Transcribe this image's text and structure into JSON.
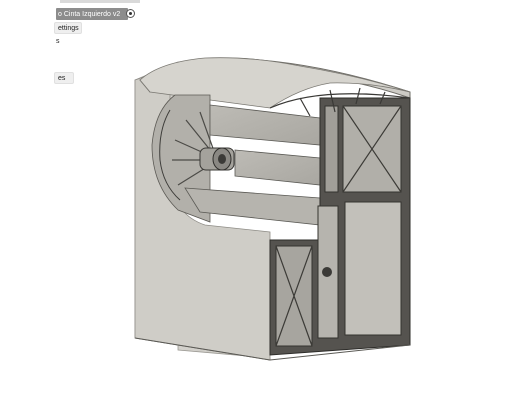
{
  "browser": {
    "document_row": {
      "label": "o Cinta Izquierdo v2"
    },
    "rows": [
      {
        "label": "ettings"
      },
      {
        "label": "s"
      },
      {
        "label": ""
      },
      {
        "label": ""
      },
      {
        "label": "es"
      }
    ]
  },
  "model": {
    "icon": "3d-part-icon",
    "body_color": "#c8c6c0",
    "edge_color": "#4a4a4a"
  }
}
